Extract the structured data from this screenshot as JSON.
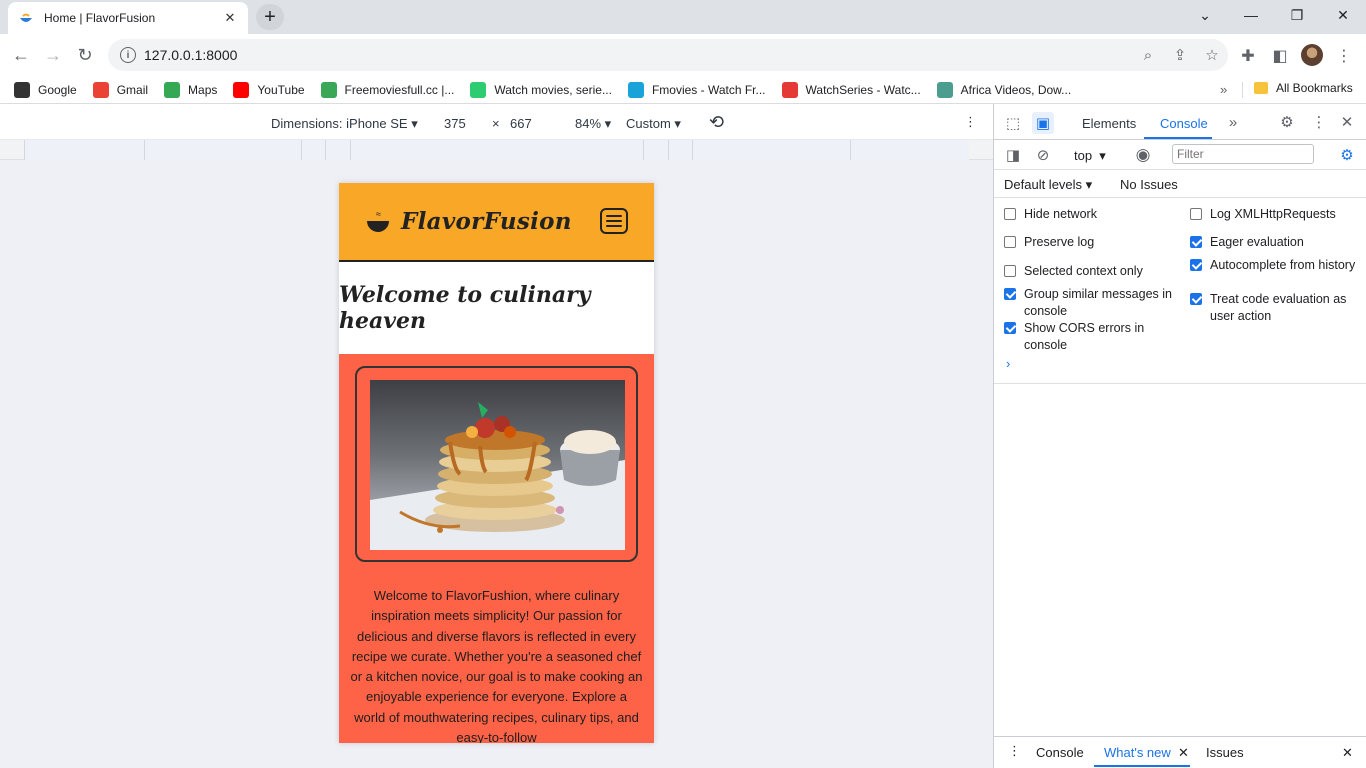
{
  "browser": {
    "tab_title": "Home | FlavorFusion",
    "url": "127.0.0.1:8000",
    "bookmarks": [
      {
        "label": "Google",
        "icon": "google-icon",
        "color": "#333333"
      },
      {
        "label": "Gmail",
        "icon": "gmail-icon",
        "color": "#ea4335"
      },
      {
        "label": "Maps",
        "icon": "maps-icon",
        "color": "#34a853"
      },
      {
        "label": "YouTube",
        "icon": "youtube-icon",
        "color": "#ff0000"
      },
      {
        "label": "Freemoviesfull.cc |...",
        "icon": "film-icon",
        "color": "#3aa757"
      },
      {
        "label": "Watch movies, serie...",
        "icon": "play-icon",
        "color": "#2ecc71"
      },
      {
        "label": "Fmovies - Watch Fr...",
        "icon": "play-circle-icon",
        "color": "#1aa3d9"
      },
      {
        "label": "WatchSeries - Watc...",
        "icon": "play-red-icon",
        "color": "#e53935"
      },
      {
        "label": "Africa Videos, Dow...",
        "icon": "d-icon",
        "color": "#4a9d8f"
      }
    ],
    "all_bookmarks": "All Bookmarks"
  },
  "device_toolbar": {
    "dimensions_label": "Dimensions: iPhone SE",
    "width": "375",
    "times": "×",
    "height": "667",
    "zoom": "84%",
    "throttle": "Custom"
  },
  "site": {
    "brand": "FlavorFusion",
    "welcome": "Welcome to culinary heaven",
    "intro": "Welcome to FlavorFushion, where culinary inspiration meets simplicity! Our passion for delicious and diverse flavors is reflected in every recipe we curate. Whether you're a seasoned chef or a kitchen novice, our goal is to make cooking an enjoyable experience for everyone. Explore a world of mouthwatering recipes, culinary tips, and easy-to-follow",
    "colors": {
      "header": "#f8a826",
      "section": "#ff6347"
    }
  },
  "devtools": {
    "tabs": [
      "Elements",
      "Console"
    ],
    "active_tab": "Console",
    "context": "top",
    "filter_placeholder": "Filter",
    "levels": "Default levels",
    "issues": "No Issues",
    "options": [
      {
        "label": "Hide network",
        "checked": false
      },
      {
        "label": "Log XMLHttpRequests",
        "checked": false
      },
      {
        "label": "Preserve log",
        "checked": false
      },
      {
        "label": "Eager evaluation",
        "checked": true
      },
      {
        "label": "Selected context only",
        "checked": false
      },
      {
        "label": "Autocomplete from history",
        "checked": true
      },
      {
        "label": "Group similar messages in console",
        "checked": true
      },
      {
        "label": "Treat code evaluation as user action",
        "checked": true
      },
      {
        "label": "Show CORS errors in console",
        "checked": true
      }
    ],
    "prompt": "›",
    "drawer_tabs": [
      "Console",
      "What's new",
      "Issues"
    ],
    "drawer_active": "What's new"
  }
}
